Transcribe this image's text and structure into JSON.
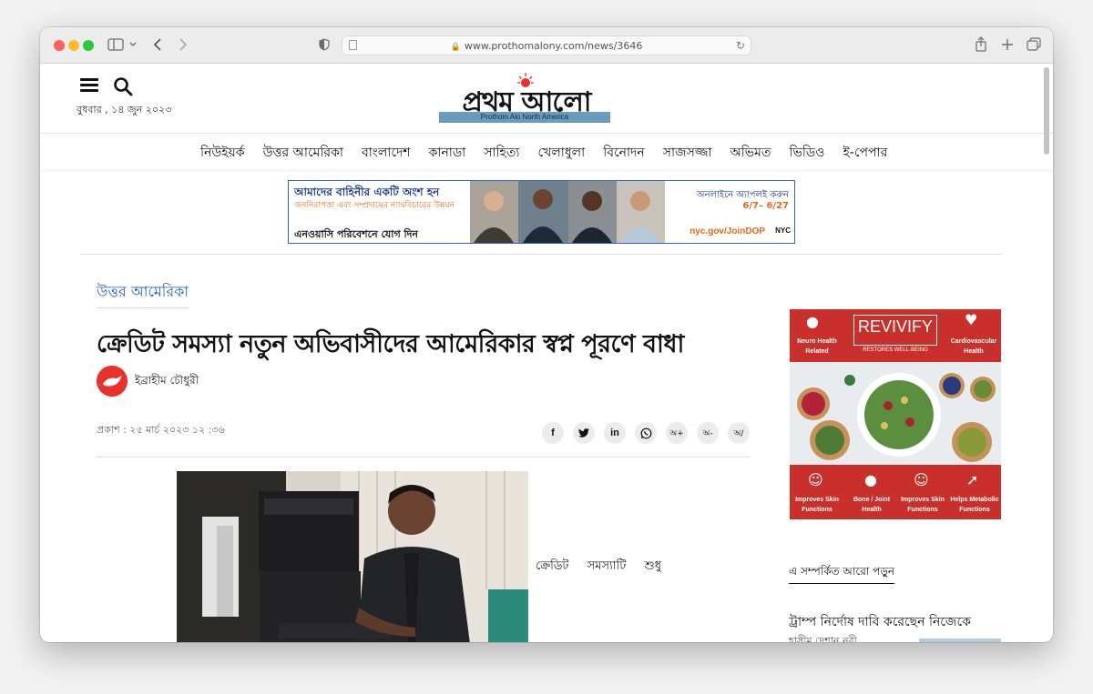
{
  "browser": {
    "url": "www.prothomalony.com/news/3646"
  },
  "header": {
    "date": "বুধবার , ১৪ জুন ২০২৩",
    "logo_text": "প্রথম আলো",
    "logo_band": "Prothom Alo North America"
  },
  "nav": {
    "items": [
      "নিউইয়র্ক",
      "উত্তর আমেরিকা",
      "বাংলাদেশ",
      "কানাডা",
      "সাহিত্য",
      "খেলাধুলা",
      "বিনোদন",
      "সাজসজ্জা",
      "অভিমত",
      "ভিডিও",
      "ই-পেপার"
    ]
  },
  "top_ad": {
    "headline": "আমাদের বাহিনীর একটি অংশ হন",
    "subline": "জননিরাপত্তা এবং সম্প্রদায়ের ন্যায়বিচারের উন্নয়ন",
    "cta": "এনওয়াসি পরিবেশনে যোগ দিন",
    "apply": "অনলাইনে অ্যাপলই করুন",
    "dates": "6/7– 6/27",
    "link": "nyc.gov/JoinDOP",
    "agency": "NYC"
  },
  "article": {
    "section": "উত্তর আমেরিকা",
    "headline": "ক্রেডিট সমস্যা নতুন অভিবাসীদের আমেরিকার স্বপ্ন পূরণে বাধা",
    "author": "ইব্রাহীম চৌধুরী",
    "published": "প্রকাশ : ২৫ মার্চ ২০২৩ ১২ :৩৬",
    "share": {
      "facebook": "f",
      "twitter": "t",
      "linkedin": "in",
      "font_increase": "অ+",
      "font_decrease": "অ-",
      "font_reset": "অ/"
    },
    "body_fragment": "ক্রেডিট সমস্যাটি শুধু"
  },
  "side_ad": {
    "brand": "REVIVIFY",
    "tagline": "RESTORES WELL-BEING",
    "labels": [
      "Neuro Health Related",
      "Cardiovascular Health",
      "Improves Skin Functions",
      "Bone / Joint Health",
      "Improves Skin Functions",
      "Helps Metabolic Functions"
    ]
  },
  "related": {
    "title": "এ সম্পর্কিত আরো পড়ুন",
    "items": [
      {
        "title": "ট্রাম্প নির্দোষ দাবি করেছেন নিজেকে",
        "sub": "হাসীম দেশান নবী"
      }
    ]
  },
  "colors": {
    "accent_blue": "#1e5fb4",
    "brand_red": "#e6322b",
    "ad_red": "#c9302c"
  }
}
